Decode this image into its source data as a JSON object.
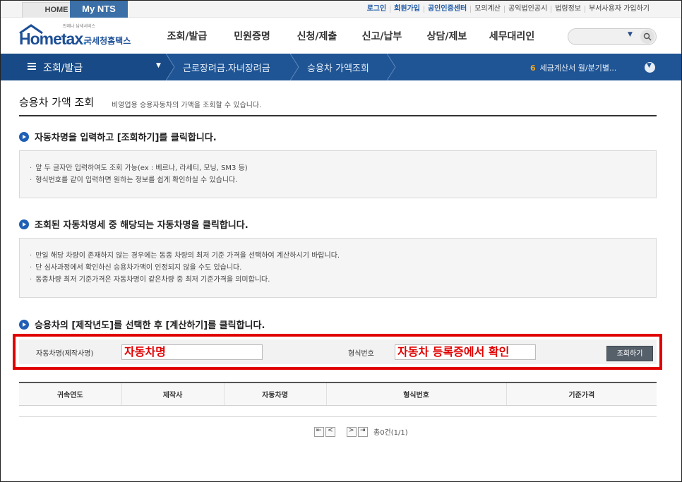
{
  "topbar": {
    "home_tab": "HOME",
    "mynts_tab": "My NTS",
    "links": [
      "로그인",
      "회원가입",
      "공인인증센터",
      "모의계산",
      "공익법인공시",
      "법령정보",
      "부서사용자 가입하기"
    ]
  },
  "logo": {
    "small_text": "언제나 납세서비스",
    "main": "Hometax",
    "kr": "국세청홈택스"
  },
  "gnb": [
    "조회/발급",
    "민원증명",
    "신청/제출",
    "신고/납부",
    "상담/제보",
    "세무대리인"
  ],
  "search": {
    "placeholder": ""
  },
  "location": {
    "level1": "조회/발급",
    "level2": "근로장려금.자녀장려금",
    "level3": "승용차 가액조회",
    "notice_num": "6",
    "notice_text": "세금계산서 월/분기별..."
  },
  "page": {
    "title": "승용차 가액 조회",
    "description": "비영업용 승용자동차의 가액을 조회할 수 있습니다."
  },
  "sections": [
    {
      "title": "자동차명을 입력하고 [조회하기]를 클릭합니다.",
      "items": [
        "앞 두 글자만 입력하여도 조회 가능(ex : 베르나, 라세티, 모닝, SM3 등)",
        "형식번호를 같이 입력하면 원하는 정보를 쉽게 확인하실 수 있습니다."
      ]
    },
    {
      "title": "조회된 자동차명세 중 해당되는 자동차명을 클릭합니다.",
      "items": [
        "만일 해당 차량이 존재하지 않는 경우에는 동종 차량의 최저 기준 가격을 선택하여 계산하시기 바랍니다.",
        "단 심사과정에서 확인하신 승용차가액이 인정되지 않을 수도 있습니다.",
        "동종차량 최저 기준가격은 자동차명이 같은차량 중  최저 기준가격을 의미합니다."
      ]
    },
    {
      "title": "승용차의 [제작년도]를 선택한 후 [계산하기]를 클릭합니다."
    }
  ],
  "form": {
    "car_name_label": "자동차명(제작사명)",
    "car_name_value": "자동차명",
    "model_label": "형식번호",
    "model_value": "자동차 등록증에서 확인",
    "search_button": "조회하기"
  },
  "table": {
    "headers": [
      "귀속연도",
      "제작사",
      "자동차명",
      "형식번호",
      "기준가격"
    ]
  },
  "pagination": {
    "first": "⇤",
    "prev": "<",
    "next": ">",
    "last": "⇥",
    "summary": "총0건(1/1)"
  },
  "colors": {
    "brand_blue": "#1f5595",
    "highlight_red": "#e00000",
    "bullet_blue": "#1f5fb5"
  }
}
